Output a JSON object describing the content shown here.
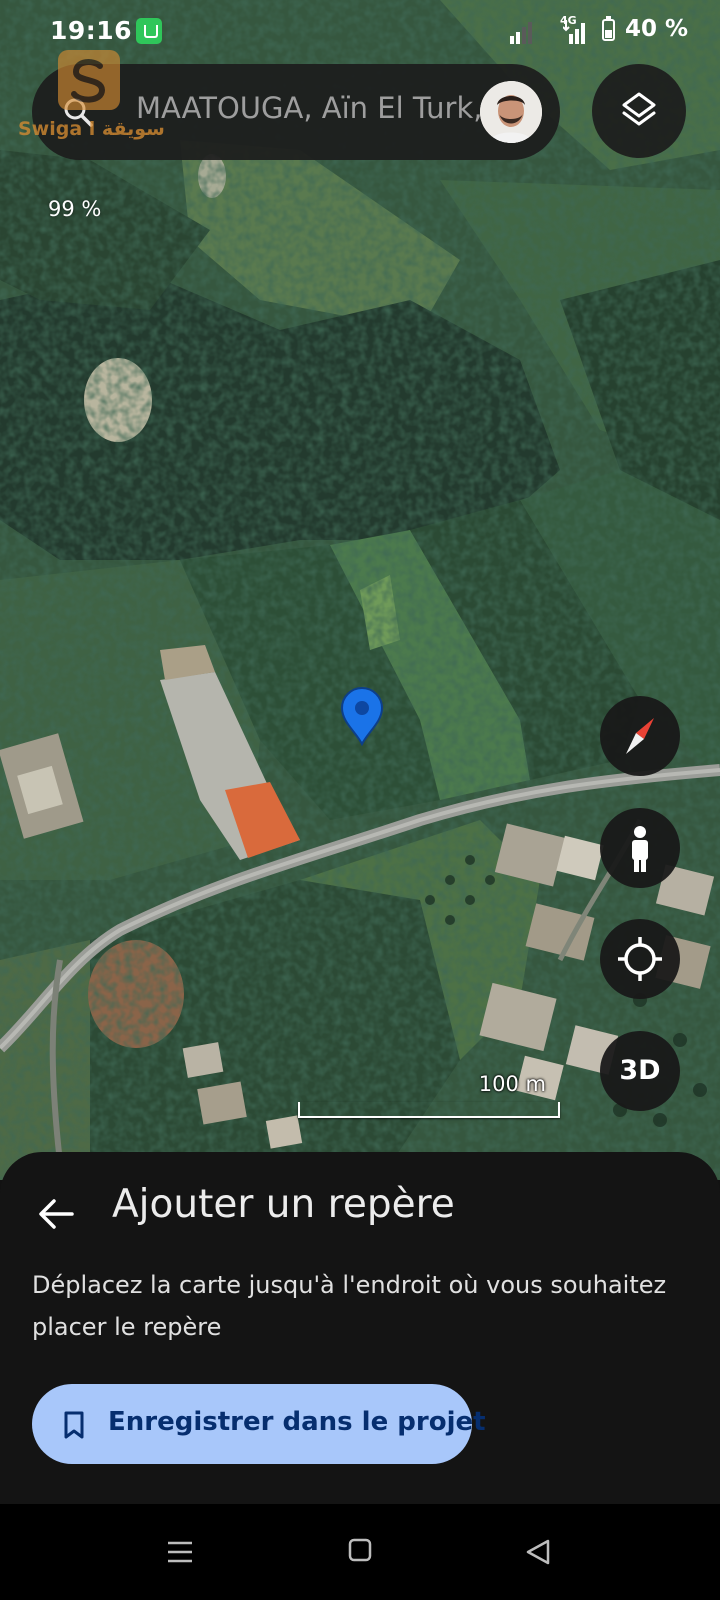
{
  "status_bar": {
    "time": "19:16",
    "network_type": "4G",
    "battery": "40 %"
  },
  "search": {
    "text": "MAATOUGA, Aïn El Turk, Oran, Algérie"
  },
  "watermark": {
    "text": "Swiga l سويقة"
  },
  "map": {
    "zoom_percent": "99 %",
    "scale_label": "100 m",
    "colors": {
      "accent_pin": "#1a73e8",
      "compass_red": "#e94235"
    }
  },
  "controls": {
    "layers_icon": "layers-icon",
    "compass_icon": "compass-icon",
    "streetview_icon": "pegman-icon",
    "my_location_icon": "my-location-icon",
    "button_3d_label": "3D"
  },
  "sheet": {
    "title": "Ajouter un repère",
    "description": "Déplacez la carte jusqu'à l'endroit où vous souhaitez placer le repère",
    "save_button_label": "Enregistrer dans le projet",
    "save_button_color": "#a8c7fa"
  },
  "nav": {
    "recents_icon": "recents-icon",
    "home_icon": "home-icon",
    "back_icon": "back-triangle-icon"
  }
}
